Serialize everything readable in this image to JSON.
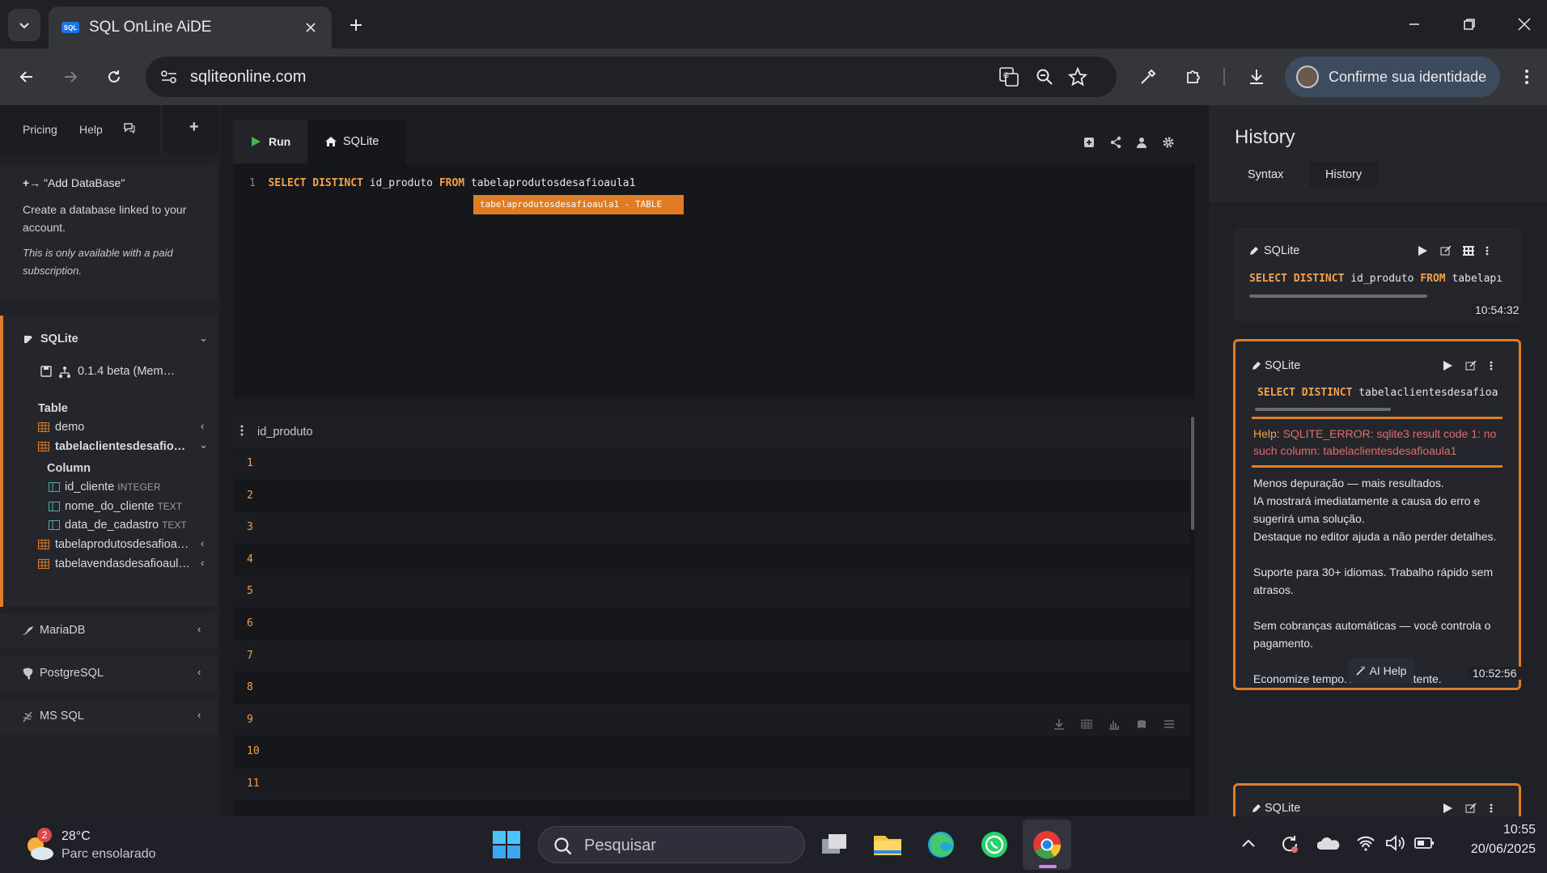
{
  "browser": {
    "tab_title": "SQL OnLine AiDE",
    "favicon_text": "SQL",
    "url": "sqliteonline.com",
    "profile_label": "Confirme sua identidade"
  },
  "app": {
    "nav": {
      "pricing": "Pricing",
      "help": "Help"
    },
    "add_db": {
      "title": "\"Add DataBase\"",
      "arrow": "+→",
      "desc": "Create a database linked to your account.",
      "note": "This is only available with a paid subscription."
    },
    "tree": {
      "sqlite": "SQLite",
      "version": "0.1.4 beta (Mem…",
      "table_header": "Table",
      "tables": [
        "demo",
        "tabelaclientesdesafio…",
        "tabelaprodutosdesafioa…",
        "tabelavendasdesafioaul…"
      ],
      "column_header": "Column",
      "columns": [
        {
          "name": "id_cliente",
          "type": "INTEGER"
        },
        {
          "name": "nome_do_cliente",
          "type": "TEXT"
        },
        {
          "name": "data_de_cadastro",
          "type": "TEXT"
        }
      ],
      "other_dbs": [
        "MariaDB",
        "PostgreSQL",
        "MS SQL"
      ]
    },
    "editor": {
      "run_label": "Run",
      "tab_label": "SQLite",
      "line_no": "1",
      "kw1": "SELECT DISTINCT",
      "col": " id_produto ",
      "kw2": "FROM",
      "tbl": " tabelaprodutosdesafioaula1",
      "hint": "tabelaprodutosdesafioaula1 - TABLE"
    },
    "results": {
      "column": "id_produto",
      "rows": [
        "1",
        "2",
        "3",
        "4",
        "5",
        "6",
        "7",
        "8",
        "9",
        "10",
        "11"
      ]
    },
    "history": {
      "title": "History",
      "tabs": [
        "Syntax",
        "History"
      ],
      "items": [
        {
          "engine": "SQLite",
          "kw": "SELECT DISTINCT",
          "rest": " id_produto ",
          "kw2": "FROM",
          "rest2": " tabelapı",
          "time": "10:54:32"
        },
        {
          "engine": "SQLite",
          "kw": "SELECT DISTINCT",
          "rest": " tabelaclientesdesafioa",
          "help_label": "Help:",
          "error": "SQLITE_ERROR: sqlite3 result code 1: no such column: tabelaclientesdesafioaula1",
          "promo": [
            "Menos depuração — mais resultados.",
            "IA mostrará imediatamente a causa do erro e sugerirá uma solução.",
            "Destaque no editor ajuda a não perder detalhes.",
            "Suporte para 30+ idiomas. Trabalho rápido sem atrasos.",
            "Sem cobranças automáticas — você controla o pagamento.",
            "Economize tempo. Ative o assistente."
          ],
          "ai_help": "AI Help",
          "time": "10:52:56"
        },
        {
          "engine": "SQLite"
        }
      ]
    }
  },
  "taskbar": {
    "weather_temp": "28°C",
    "weather_desc": "Parc ensolarado",
    "weather_badge": "2",
    "search_placeholder": "Pesquisar",
    "time": "10:55",
    "date": "20/06/2025"
  },
  "colors": {
    "accent": "#e07c24",
    "error": "#e06c6c",
    "keyword": "#f5a14b"
  }
}
